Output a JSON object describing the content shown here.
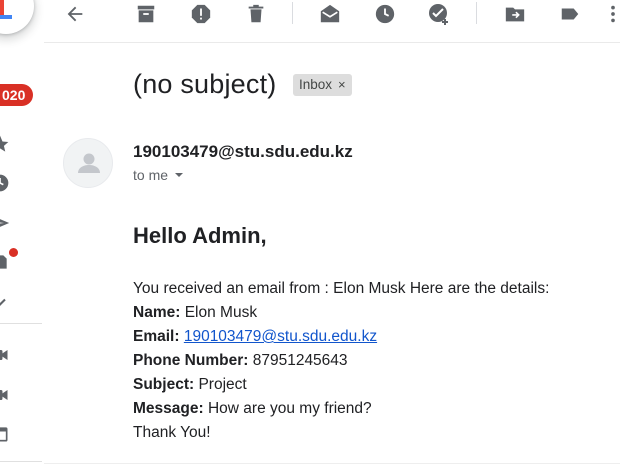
{
  "rail": {
    "badge": "020",
    "icons": [
      "compose-plus-icon",
      "star-icon",
      "clock-icon",
      "send-icon",
      "draft-icon",
      "chevron-down-icon",
      "meet-video-icon",
      "keyboard-icon",
      "calendar-icon"
    ]
  },
  "toolbar": {
    "buttons": [
      "back-icon",
      "archive-icon",
      "report-spam-icon",
      "delete-icon",
      "mark-unread-icon",
      "snooze-icon",
      "add-to-tasks-icon",
      "move-to-icon",
      "label-icon",
      "more-icon"
    ]
  },
  "message": {
    "subject": "(no subject)",
    "label_chip": "Inbox",
    "label_chip_close": "×",
    "sender": "190103479@stu.sdu.edu.kz",
    "to": "to me",
    "greeting": "Hello Admin,",
    "intro": "You received an email from : Elon Musk Here are the details:",
    "fields": {
      "name_label": "Name:",
      "name_value": "Elon Musk",
      "email_label": "Email:",
      "email_value": "190103479@stu.sdu.edu.kz",
      "phone_label": "Phone Number:",
      "phone_value": "87951245643",
      "subject_label": "Subject:",
      "subject_value": "Project",
      "message_label": "Message:",
      "message_value": "How are you my friend?"
    },
    "signoff": "Thank You!"
  },
  "colors": {
    "badge": "#d93025",
    "link": "#1155cc",
    "icon": "#5f6368",
    "chip_bg": "#dddddd"
  }
}
